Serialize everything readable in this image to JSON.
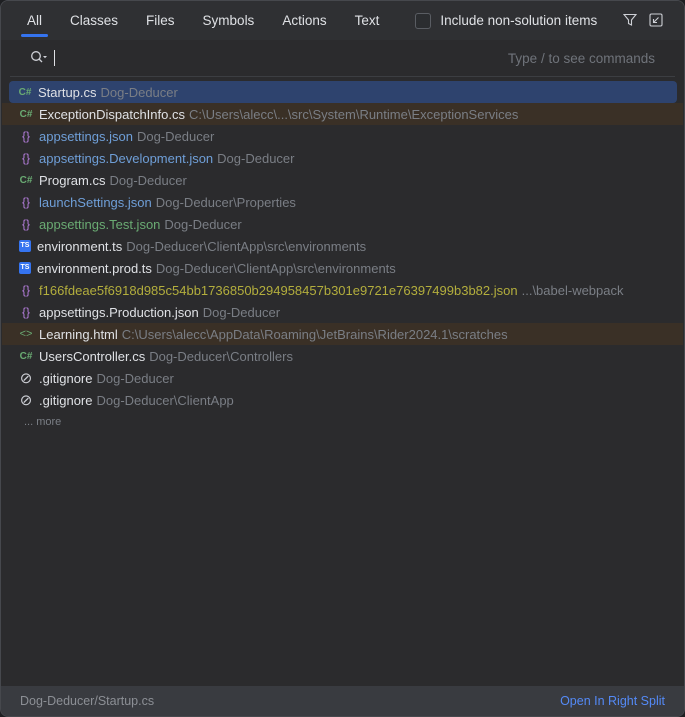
{
  "tabs": [
    "All",
    "Classes",
    "Files",
    "Symbols",
    "Actions",
    "Text"
  ],
  "include_label": "Include non-solution items",
  "search": {
    "value": "",
    "hint": "Type / to see commands"
  },
  "colors": {
    "accent": "#3574f0",
    "selected": "#2e436e",
    "highlight": "#3a3026",
    "white": "#dfe1e5",
    "blue": "#6f9fd8",
    "green": "#6aab73",
    "olive": "#b3ae3d",
    "path": "#7a7e85"
  },
  "results": [
    {
      "icon": "csharp-icon",
      "name": "Startup.cs",
      "path": "Dog-Deducer",
      "color": "white",
      "state": "selected"
    },
    {
      "icon": "csharp-icon",
      "name": "ExceptionDispatchInfo.cs",
      "path": "C:\\Users\\alecc\\...\\src\\System\\Runtime\\ExceptionServices",
      "color": "white",
      "state": "highlight"
    },
    {
      "icon": "json-icon",
      "name": "appsettings.json",
      "path": "Dog-Deducer",
      "color": "blue",
      "state": ""
    },
    {
      "icon": "json-icon",
      "name": "appsettings.Development.json",
      "path": "Dog-Deducer",
      "color": "blue",
      "state": ""
    },
    {
      "icon": "csharp-icon",
      "name": "Program.cs",
      "path": "Dog-Deducer",
      "color": "white",
      "state": ""
    },
    {
      "icon": "json-icon",
      "name": "launchSettings.json",
      "path": "Dog-Deducer\\Properties",
      "color": "blue",
      "state": ""
    },
    {
      "icon": "json-icon",
      "name": "appsettings.Test.json",
      "path": "Dog-Deducer",
      "color": "green",
      "state": ""
    },
    {
      "icon": "typescript-icon",
      "name": "environment.ts",
      "path": "Dog-Deducer\\ClientApp\\src\\environments",
      "color": "white",
      "state": ""
    },
    {
      "icon": "typescript-icon",
      "name": "environment.prod.ts",
      "path": "Dog-Deducer\\ClientApp\\src\\environments",
      "color": "white",
      "state": ""
    },
    {
      "icon": "json-icon",
      "name": "f166fdeae5f6918d985c54bb1736850b294958457b301e9721e76397499b3b82.json",
      "path": "...\\babel-webpack",
      "color": "olive",
      "state": ""
    },
    {
      "icon": "json-icon",
      "name": "appsettings.Production.json",
      "path": "Dog-Deducer",
      "color": "white",
      "state": ""
    },
    {
      "icon": "html-scratch-icon",
      "name": "Learning.html",
      "path": "C:\\Users\\alecc\\AppData\\Roaming\\JetBrains\\Rider2024.1\\scratches",
      "color": "white",
      "state": "highlight"
    },
    {
      "icon": "csharp-icon",
      "name": "UsersController.cs",
      "path": "Dog-Deducer\\Controllers",
      "color": "white",
      "state": ""
    },
    {
      "icon": "gitignore-icon",
      "name": ".gitignore",
      "path": "Dog-Deducer",
      "color": "white",
      "state": ""
    },
    {
      "icon": "gitignore-icon",
      "name": ".gitignore",
      "path": "Dog-Deducer\\ClientApp",
      "color": "white",
      "state": ""
    }
  ],
  "more_label": "... more",
  "footer": {
    "path": "Dog-Deducer/Startup.cs",
    "action": "Open In Right Split"
  }
}
